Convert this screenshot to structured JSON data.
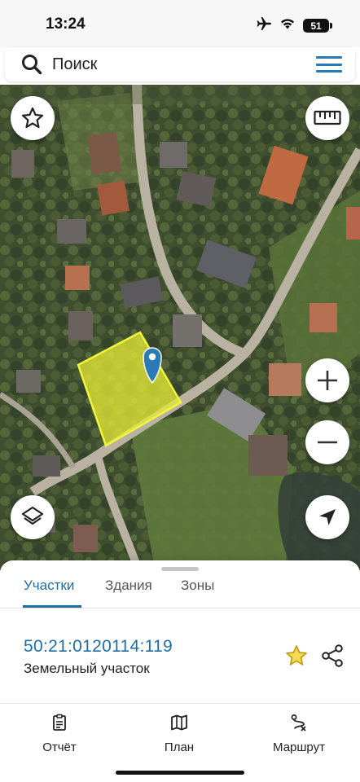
{
  "status_bar": {
    "time": "13:24",
    "battery": "51",
    "icons": [
      "airplane-icon",
      "wifi-icon",
      "battery-icon"
    ]
  },
  "search": {
    "placeholder": "Поиск"
  },
  "map": {
    "selected_parcel_color": "#e2e836",
    "pin_color": "#2a7ab8",
    "controls": [
      "favorites-star-icon",
      "ruler-icon",
      "zoom-in-icon",
      "zoom-out-icon",
      "layers-icon",
      "location-arrow-icon"
    ]
  },
  "sheet": {
    "tabs": [
      {
        "label": "Участки",
        "active": true
      },
      {
        "label": "Здания",
        "active": false
      },
      {
        "label": "Зоны",
        "active": false
      }
    ],
    "parcel": {
      "cadastral_number": "50:21:0120114:119",
      "type": "Земельный участок"
    }
  },
  "bottom_nav": [
    {
      "label": "Отчёт",
      "icon": "report-icon"
    },
    {
      "label": "План",
      "icon": "map-icon"
    },
    {
      "label": "Маршрут",
      "icon": "route-icon"
    }
  ],
  "colors": {
    "accent": "#1c6ea8",
    "star": "#f2c500"
  }
}
